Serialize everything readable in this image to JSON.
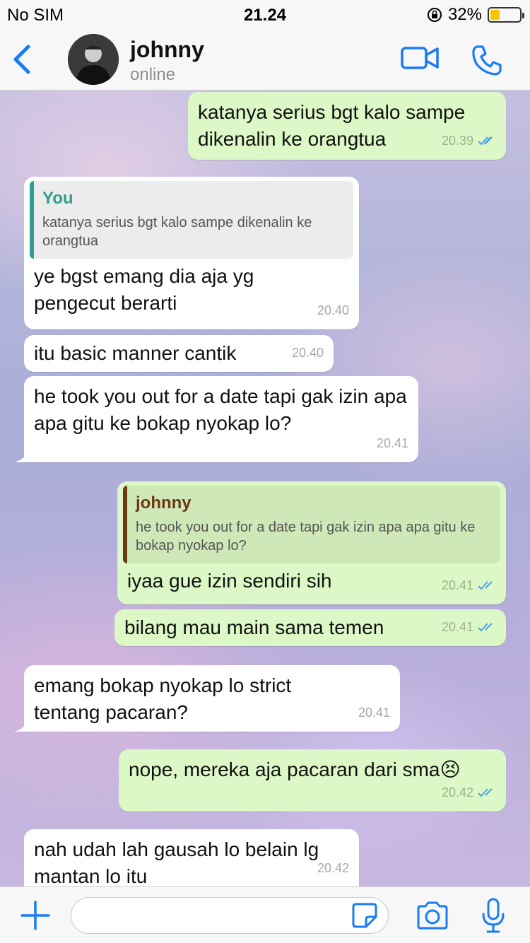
{
  "status_bar": {
    "carrier": "No SIM",
    "time": "21.24",
    "battery": "32%",
    "battery_level": 0.32
  },
  "header": {
    "back_icon": "chevron-left-icon",
    "name": "johnny",
    "status": "online",
    "video_icon": "video-icon",
    "call_icon": "phone-icon"
  },
  "colors": {
    "accent": "#1a7cf2",
    "outgoing": "#dcf8c6",
    "incoming": "#ffffff",
    "read_ticks": "#4fa3e6"
  },
  "messages": [
    {
      "dir": "out",
      "text": "katanya serius bgt kalo sampe dikenalin ke orangtua",
      "time": "20.39",
      "read": true
    },
    {
      "dir": "in",
      "reply_author": "You",
      "reply_text": "katanya serius bgt kalo sampe dikenalin ke orangtua",
      "text": "ye bgst emang dia aja yg pengecut berarti",
      "time": "20.40"
    },
    {
      "dir": "in",
      "text": "itu basic manner cantik",
      "time": "20.40"
    },
    {
      "dir": "in",
      "text": "he took you out for a date tapi gak izin apa apa gitu ke bokap nyokap lo?",
      "time": "20.41"
    },
    {
      "dir": "out",
      "reply_author": "johnny",
      "reply_text": "he took you out for a date tapi gak izin apa apa gitu ke bokap nyokap lo?",
      "text": "iyaa gue izin sendiri sih",
      "time": "20.41",
      "read": true
    },
    {
      "dir": "out",
      "text": "bilang mau main sama temen",
      "time": "20.41",
      "read": true
    },
    {
      "dir": "in",
      "text": "emang bokap nyokap lo strict tentang pacaran?",
      "time": "20.41"
    },
    {
      "dir": "out",
      "text": "nope, mereka aja pacaran dari sma😣",
      "time": "20.42",
      "read": true
    },
    {
      "dir": "in",
      "text": "nah udah lah gausah lo belain lg mantan lo itu",
      "time": "20.42"
    }
  ],
  "input": {
    "placeholder": "",
    "value": ""
  }
}
